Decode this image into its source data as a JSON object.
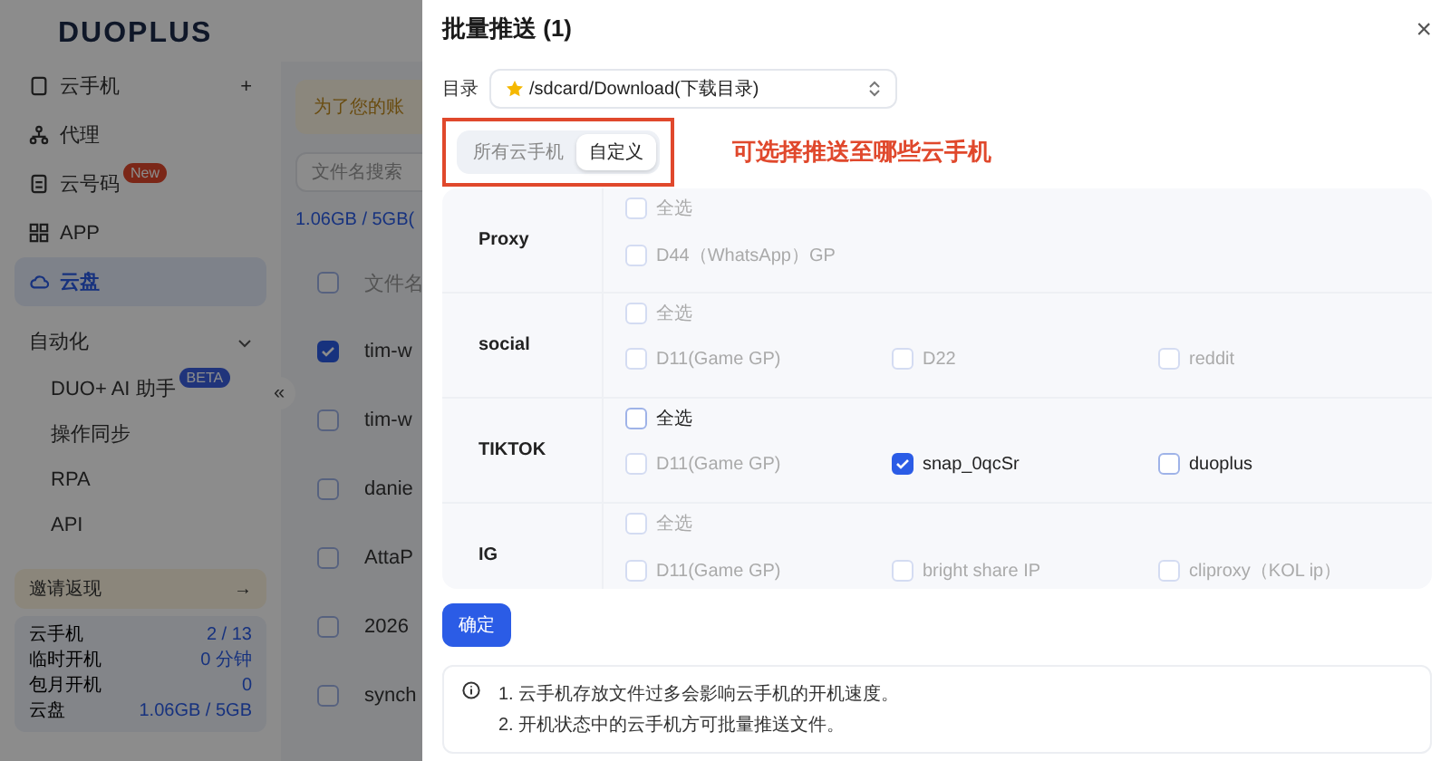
{
  "app": {
    "logo": "DUOPLUS",
    "sidebar": {
      "items": [
        {
          "label": "云手机",
          "selected": false,
          "action": "+"
        },
        {
          "label": "代理",
          "selected": false
        },
        {
          "label": "云号码",
          "selected": false,
          "badge": "New"
        },
        {
          "label": "APP",
          "selected": false
        },
        {
          "label": "云盘",
          "selected": true
        }
      ],
      "section": {
        "label": "自动化",
        "expanded": true,
        "children": [
          {
            "label": "DUO+ AI 助手",
            "badge": "BETA"
          },
          {
            "label": "操作同步"
          },
          {
            "label": "RPA"
          },
          {
            "label": "API"
          }
        ]
      },
      "invite": {
        "label": "邀请返现",
        "arrow": "→"
      },
      "stats": [
        {
          "label": "云手机",
          "value": "2 / 13"
        },
        {
          "label": "临时开机",
          "value": "0 分钟"
        },
        {
          "label": "包月开机",
          "value": "0"
        },
        {
          "label": "云盘",
          "value": "1.06GB / 5GB"
        }
      ]
    },
    "collapse": "«",
    "notice": "为了您的账",
    "search": {
      "placeholder": "文件名搜索"
    },
    "storage": "1.06GB / 5GB(",
    "table": {
      "header": "文件名",
      "header_checked": false,
      "rows": [
        {
          "name": "tim-w",
          "selected": true
        },
        {
          "name": "tim-w",
          "selected": false
        },
        {
          "name": "danie",
          "selected": false
        },
        {
          "name": "AttaP",
          "selected": false
        },
        {
          "name": "2026",
          "selected": false
        },
        {
          "name": "synch",
          "selected": false
        }
      ]
    }
  },
  "dialog": {
    "title": "批量推送 (1)",
    "close": "×",
    "directory": {
      "label": "目录",
      "value": "/sdcard/Download(下载目录)"
    },
    "scope_tabs": [
      {
        "label": "所有云手机",
        "selected": false
      },
      {
        "label": "自定义",
        "selected": true
      }
    ],
    "annotation": "可选择推送至哪些云手机",
    "groups": [
      {
        "name": "Proxy",
        "select_all": {
          "label": "全选",
          "checked": false,
          "disabled": true
        },
        "phones": [
          {
            "label": "D44（WhatsApp）GP",
            "checked": false,
            "disabled": true
          }
        ]
      },
      {
        "name": "social",
        "select_all": {
          "label": "全选",
          "checked": false,
          "disabled": true
        },
        "phones": [
          {
            "label": "D11(Game GP)",
            "checked": false,
            "disabled": true
          },
          {
            "label": "D22",
            "checked": false,
            "disabled": true
          },
          {
            "label": "reddit",
            "checked": false,
            "disabled": true
          }
        ]
      },
      {
        "name": "TIKTOK",
        "select_all": {
          "label": "全选",
          "checked": false,
          "disabled": false
        },
        "phones": [
          {
            "label": "D11(Game GP)",
            "checked": false,
            "disabled": true
          },
          {
            "label": "snap_0qcSr",
            "checked": true,
            "disabled": false
          },
          {
            "label": "duoplus",
            "checked": false,
            "disabled": false
          }
        ]
      },
      {
        "name": "IG",
        "select_all": {
          "label": "全选",
          "checked": false,
          "disabled": true
        },
        "phones": [
          {
            "label": "D11(Game GP)",
            "checked": false,
            "disabled": true
          },
          {
            "label": "bright share IP",
            "checked": false,
            "disabled": true
          },
          {
            "label": "cliproxy（KOL ip）",
            "checked": false,
            "disabled": true
          }
        ]
      }
    ],
    "confirm": "确定",
    "tips": [
      "1. 云手机存放文件过多会影响云手机的开机速度。",
      "2. 开机状态中的云手机方可批量推送文件。"
    ]
  }
}
